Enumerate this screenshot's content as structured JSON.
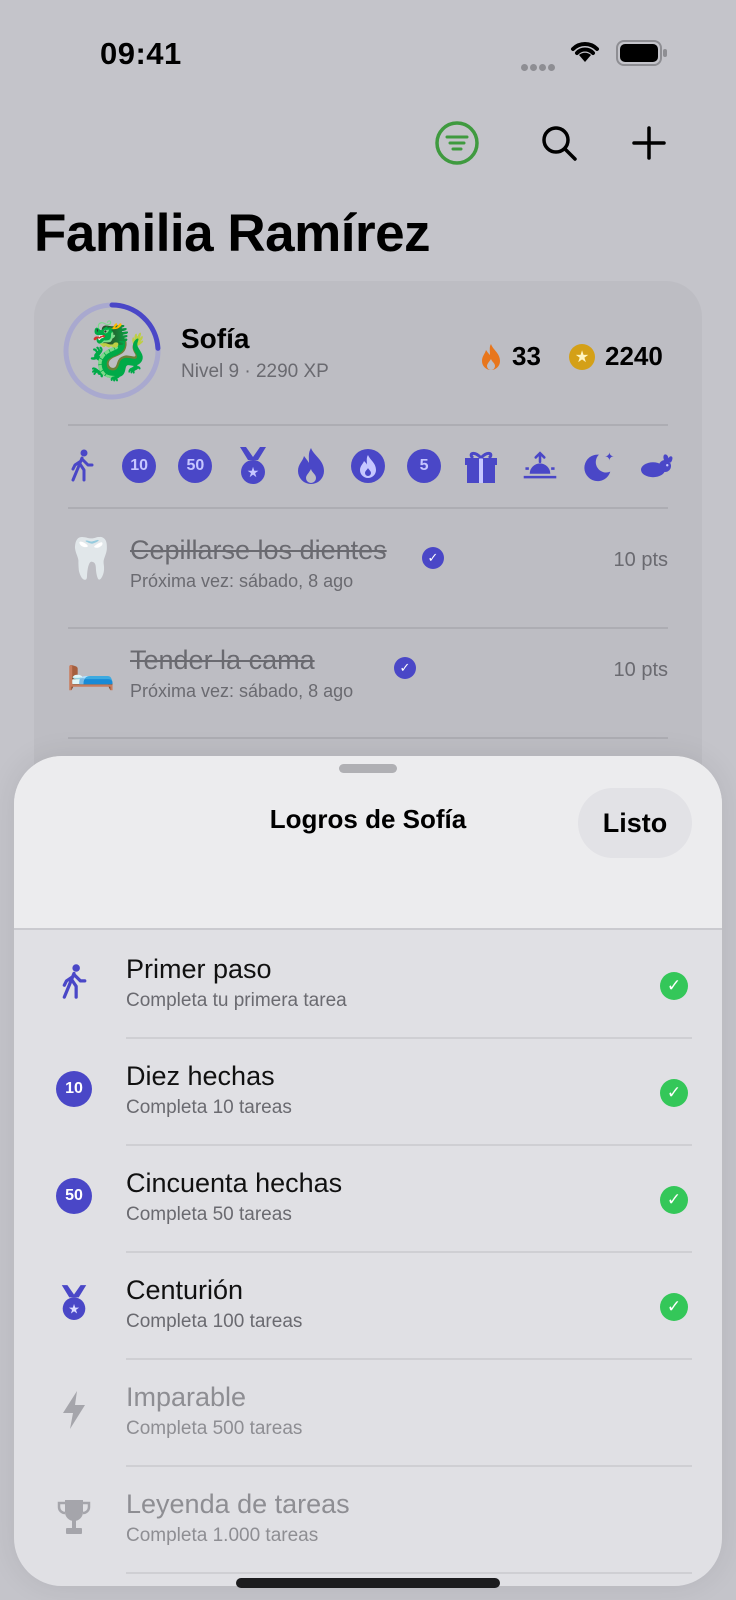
{
  "status_bar": {
    "time": "09:41"
  },
  "toolbar": {
    "filter_icon": "filter-lines-icon",
    "search_icon": "search-icon",
    "add_icon": "plus-icon",
    "accent": "#3f9a3f"
  },
  "page": {
    "title": "Familia Ramírez"
  },
  "member": {
    "emoji": "🐉",
    "name": "Sofía",
    "subtitle": "Nivel 9 · 2290 XP",
    "streak": "33",
    "coins": "2240",
    "level_progress": 0.24
  },
  "badges": [
    {
      "icon": "walking-icon"
    },
    {
      "icon": "number-badge-icon",
      "label": "10"
    },
    {
      "icon": "number-badge-icon",
      "label": "50"
    },
    {
      "icon": "medal-icon"
    },
    {
      "icon": "flame-icon"
    },
    {
      "icon": "flame-circle-icon"
    },
    {
      "icon": "number-badge-icon",
      "label": "5"
    },
    {
      "icon": "gift-icon"
    },
    {
      "icon": "sunrise-icon"
    },
    {
      "icon": "moon-stars-icon"
    },
    {
      "icon": "hare-icon"
    }
  ],
  "chores": [
    {
      "emoji": "🦷",
      "title": "Cepillarse los dientes",
      "next": "Próxima vez: sábado, 8 ago",
      "points": "10 pts"
    },
    {
      "emoji": "🛏️",
      "title": "Tender la cama",
      "next": "Próxima vez: sábado, 8 ago",
      "points": "10 pts"
    }
  ],
  "sheet": {
    "title": "Logros de Sofía",
    "done_label": "Listo",
    "achievements": [
      {
        "icon": "walking-icon",
        "title": "Primer paso",
        "desc": "Completa tu primera tarea",
        "done": true
      },
      {
        "icon": "number-badge-icon",
        "label": "10",
        "title": "Diez hechas",
        "desc": "Completa 10 tareas",
        "done": true
      },
      {
        "icon": "number-badge-icon",
        "label": "50",
        "title": "Cincuenta hechas",
        "desc": "Completa 50 tareas",
        "done": true
      },
      {
        "icon": "medal-icon",
        "title": "Centurión",
        "desc": "Completa 100 tareas",
        "done": true
      },
      {
        "icon": "bolt-icon",
        "title": "Imparable",
        "desc": "Completa 500 tareas",
        "done": false
      },
      {
        "icon": "trophy-icon",
        "title": "Leyenda de tareas",
        "desc": "Completa 1.000 tareas",
        "done": false
      }
    ]
  }
}
